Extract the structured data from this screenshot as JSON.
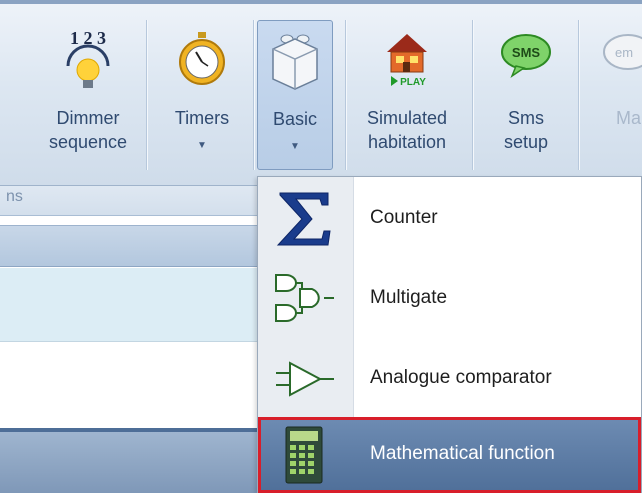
{
  "ribbon": {
    "buttons": [
      {
        "label_line1": "Dimmer",
        "label_line2": "sequence",
        "icon": "dimmer-bulb-123-icon",
        "digits": "1 2 3"
      },
      {
        "label_line1": "Timers",
        "label_line2": "",
        "icon": "stopwatch-icon",
        "has_dropdown": true
      },
      {
        "label_line1": "Basic",
        "label_line2": "",
        "icon": "lego-brick-icon",
        "has_dropdown": true,
        "pressed": true
      },
      {
        "label_line1": "Simulated",
        "label_line2": "habitation",
        "icon": "house-play-icon",
        "badge": "PLAY"
      },
      {
        "label_line1": "Sms",
        "label_line2": "setup",
        "icon": "sms-bubble-icon",
        "badge": "SMS"
      },
      {
        "label_line1": "Ma",
        "label_line2": "",
        "icon": "email-bubble-icon",
        "badge": "em"
      }
    ],
    "group_label": "ns"
  },
  "menu": {
    "items": [
      {
        "label": "Counter",
        "icon": "sigma-icon",
        "selected": false
      },
      {
        "label": "Multigate",
        "icon": "logic-gates-icon",
        "selected": false
      },
      {
        "label": "Analogue comparator",
        "icon": "comparator-icon",
        "selected": false
      },
      {
        "label": "Mathematical function",
        "icon": "calculator-icon",
        "selected": true
      }
    ]
  },
  "colors": {
    "accent_selected": "#5a79a3",
    "highlight_border": "#d81e2a",
    "ribbon_text": "#2f4a70"
  }
}
